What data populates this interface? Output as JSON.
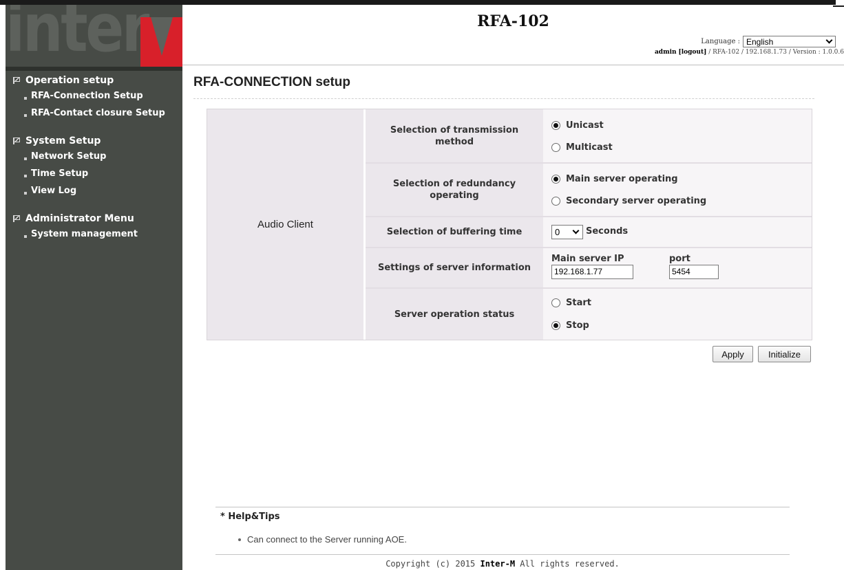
{
  "header": {
    "title": "RFA-102",
    "language_label": "Language :",
    "language_value": "English",
    "user": "admin",
    "logout": "[logout]",
    "info": "/ RFA-102 / 192.168.1.73 / Version : 1.0.0.6"
  },
  "logo": {
    "text": "inter",
    "brand_color": "#d8202a"
  },
  "sidebar": {
    "groups": [
      {
        "label": "Operation setup",
        "items": [
          "RFA-Connection Setup",
          "RFA-Contact closure Setup"
        ]
      },
      {
        "label": "System Setup",
        "items": [
          "Network Setup",
          "Time Setup",
          "View Log"
        ]
      },
      {
        "label": "Administrator Menu",
        "items": [
          "System management"
        ]
      }
    ]
  },
  "main": {
    "page_title": "RFA-CONNECTION setup",
    "client_label": "Audio Client",
    "rows": {
      "transmission": {
        "label": "Selection of transmission method",
        "options": [
          "Unicast",
          "Multicast"
        ],
        "selected": "Unicast"
      },
      "redundancy": {
        "label": "Selection of redundancy operating",
        "options": [
          "Main server operating",
          "Secondary server operating"
        ],
        "selected": "Main server operating"
      },
      "buffering": {
        "label": "Selection of buffering time",
        "value": "0",
        "unit": "Seconds"
      },
      "server_info": {
        "label": "Settings of server information",
        "ip_label": "Main server IP",
        "ip_value": "192.168.1.77",
        "port_label": "port",
        "port_value": "5454"
      },
      "status": {
        "label": "Server operation status",
        "options": [
          "Start",
          "Stop"
        ],
        "selected": "Stop"
      }
    },
    "apply_label": "Apply",
    "initialize_label": "Initialize"
  },
  "help": {
    "title": "* Help&Tips",
    "tip": "Can connect to the Server running AOE."
  },
  "footer": {
    "prefix": "Copyright (c) 2015 ",
    "brand": "Inter-M",
    "suffix": " All rights reserved."
  }
}
